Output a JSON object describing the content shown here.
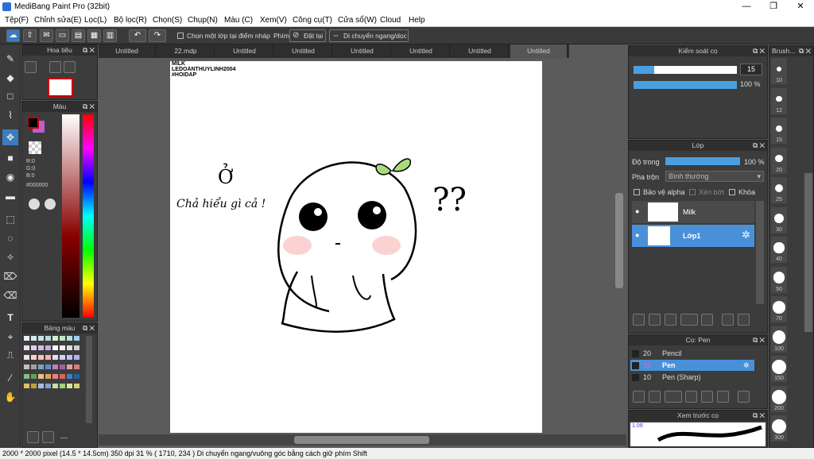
{
  "window": {
    "title": "MediBang Paint Pro (32bit)",
    "min": "—",
    "max": "❐",
    "close": "✕"
  },
  "menu": [
    "Tệp(F)",
    "Chỉnh sửa(E)",
    "Lọc(L)",
    "Bộ lọc(R)",
    "Chọn(S)",
    "Chụp(N)",
    "Màu (C)",
    "Xem(V)",
    "Công cụ(T)",
    "Cửa sổ(W)",
    "Cloud",
    "Help"
  ],
  "toolbar": {
    "snap_label": "Chọn một lớp tại điểm nháp",
    "phim_label": "Phím",
    "reset_label": "Đặt lại",
    "move_label": "Di chuyển ngang/dọc"
  },
  "tabs": [
    "Untitled",
    "22.mdp",
    "Untitled",
    "Untitled",
    "Untitled",
    "Untitled",
    "Untitled",
    "Untitled"
  ],
  "navigator": {
    "title": "Hoa tiêu"
  },
  "color": {
    "title": "Màu",
    "r": "R:0",
    "g": "G:0",
    "b": "B:0",
    "hex": "#000000"
  },
  "palette": {
    "title": "Bảng màu",
    "dash": "---"
  },
  "brush_control": {
    "title": "Kiểm soát cọ",
    "size": "15",
    "opacity": "100 %",
    "size_fill": 0.2,
    "opacity_fill": 1.0
  },
  "layers": {
    "title": "Lớp",
    "opacity_label": "Độ trong",
    "opacity_value": "100 %",
    "blend_label": "Pha trộn",
    "blend_value": "Bình thường",
    "protect_alpha": "Bảo vệ alpha",
    "clipping": "Xén bớt",
    "lock": "Khóa",
    "items": [
      {
        "name": "Milk",
        "selected": false
      },
      {
        "name": "Lớp1",
        "selected": true
      }
    ]
  },
  "brush_list": {
    "title": "Cọ: Pen",
    "items": [
      {
        "size": "20",
        "name": "Pencil",
        "selected": false
      },
      {
        "size": "15",
        "name": "Pen",
        "selected": true
      },
      {
        "size": "10",
        "name": "Pen (Sharp)",
        "selected": false
      }
    ]
  },
  "brush_preview": {
    "title": "Xem trước cọ",
    "size": "1.09"
  },
  "brush_sizes": {
    "title": "Brush...",
    "items": [
      "10",
      "12",
      "15",
      "20",
      "25",
      "30",
      "40",
      "50",
      "70",
      "100",
      "150",
      "200",
      "300"
    ]
  },
  "canvas_text": {
    "line1": "MILK",
    "line2": "LEDOANTHUYLINH2004",
    "line3": "#HOIDAP",
    "o": "Ở",
    "caption": "Chả hiểu gì cả !",
    "qq": "??"
  },
  "status": "2000 * 2000 pixel  (14.5 * 14.5cm)  350 dpi  31 %  ( 1710, 234 )  Di chuyển ngang/vuông góc bằng cách giữ phím Shift",
  "colors": {
    "accent": "#3b7bbf",
    "layer_selected": "#4a90d9"
  }
}
